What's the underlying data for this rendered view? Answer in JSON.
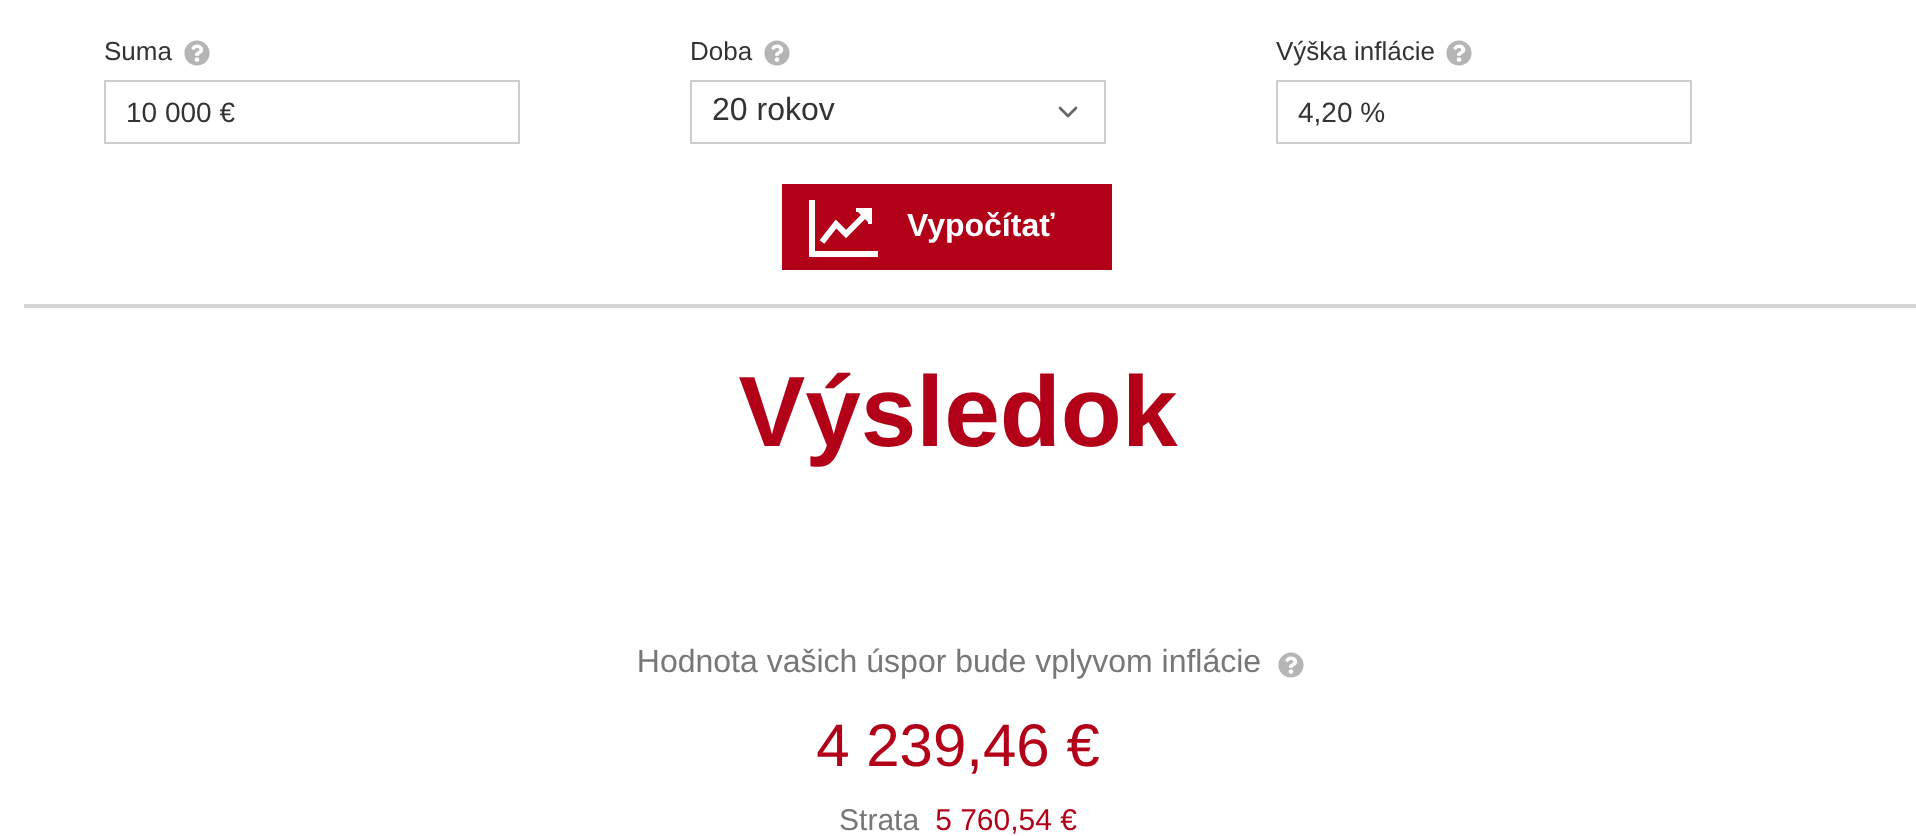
{
  "fields": [
    {
      "kind": "input",
      "label": "Suma",
      "value": "10 000 €"
    },
    {
      "kind": "select",
      "label": "Doba",
      "value": "20 rokov"
    },
    {
      "kind": "input",
      "label": "Výška inflácie",
      "value": "4,20 %"
    }
  ],
  "calculate_button": "Vypočítať",
  "result": {
    "heading": "Výsledok",
    "description": "Hodnota vašich úspor bude vplyvom inflácie",
    "amount": "4 239,46 €",
    "loss_label": "Strata",
    "loss_value": "5 760,54 €"
  }
}
